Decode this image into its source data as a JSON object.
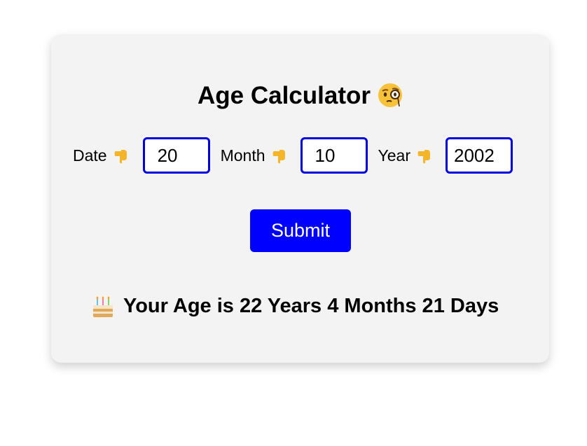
{
  "app": {
    "title": "Age Calculator",
    "title_icon": "face-with-monocle-icon"
  },
  "form": {
    "date_label": "Date",
    "month_label": "Month",
    "year_label": "Year",
    "pointer_icon": "backhand-index-pointing-down-icon",
    "date_value": "20",
    "month_value": "10",
    "year_value": "2002",
    "submit_label": "Submit"
  },
  "result": {
    "icon": "birthday-cake-icon",
    "text": "Your Age is 22 Years 4 Months 21 Days"
  },
  "colors": {
    "accent": "#0000ff",
    "card_bg": "#f3f3f3",
    "input_border": "#0000e0"
  }
}
